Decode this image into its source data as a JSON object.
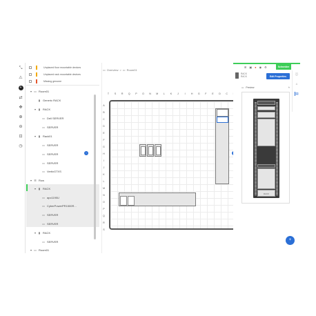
{
  "warnings": [
    {
      "label": "Unplaced floor mountable devices",
      "color": "#f2a900"
    },
    {
      "label": "Unplaced rack mountable devices",
      "color": "#f2a900"
    },
    {
      "label": "Missing genome",
      "color": "#e4572e"
    }
  ],
  "tree": [
    {
      "label": "Room01",
      "icon": "room-icon",
      "twisty": "▾"
    },
    {
      "label": "Generic RACK",
      "icon": "rack-icon"
    },
    {
      "label": "RACK",
      "icon": "rack-icon",
      "twisty": "▾"
    },
    {
      "label": "Dell SERVER",
      "icon": "server-icon"
    },
    {
      "label": "SERVER",
      "icon": "server-icon"
    },
    {
      "label": "Rack01",
      "icon": "rack-icon",
      "twisty": "▾"
    },
    {
      "label": "SERVER",
      "icon": "server-icon"
    },
    {
      "label": "SERVER",
      "icon": "server-icon"
    },
    {
      "label": "SERVER",
      "icon": "server-icon"
    },
    {
      "label": "VertivGTXS",
      "icon": "server-icon"
    },
    {
      "label": "Row",
      "icon": "row-icon",
      "twisty": "▾"
    },
    {
      "label": "RACK",
      "icon": "rack-icon",
      "twisty": "▾"
    },
    {
      "label": "apc1190U",
      "icon": "server-icon"
    },
    {
      "label": "CyberPowerPR1500R...",
      "icon": "server-icon"
    },
    {
      "label": "SERVER",
      "icon": "server-icon"
    },
    {
      "label": "SERVER",
      "icon": "server-icon"
    },
    {
      "label": "RACK",
      "icon": "rack-icon",
      "twisty": "▾"
    },
    {
      "label": "SERVER",
      "icon": "server-icon"
    },
    {
      "label": "Room01",
      "icon": "room-icon",
      "twisty": "▾"
    }
  ],
  "breadcrumb": {
    "root": "Overview",
    "sep": ">",
    "current": "Room01"
  },
  "ruler": {
    "top": [
      "T",
      "S",
      "R",
      "Q",
      "P",
      "O",
      "N",
      "M",
      "L",
      "K",
      "J",
      "I",
      "H",
      "G",
      "F",
      "E",
      "D",
      "C",
      "B",
      "A"
    ],
    "left": [
      "A",
      "B",
      "C",
      "D",
      "E",
      "F",
      "G",
      "H",
      "I",
      "J",
      "K",
      "L",
      "M",
      "N",
      "O",
      "P",
      "Q",
      "R",
      "S",
      "T",
      "U",
      "V",
      "W",
      "X",
      "Y",
      "Z"
    ],
    "right": [
      "1",
      "2",
      "3",
      "4",
      "5",
      "6",
      "7",
      "8",
      "9",
      "10",
      "11",
      "12",
      "13",
      "14",
      "15",
      "16",
      "17",
      "18",
      "19",
      "20"
    ]
  },
  "handles": {
    "left": "‹",
    "right": "›"
  },
  "header_icons": [
    "cart-icon",
    "box-icon",
    "bell-icon",
    "user-icon",
    "settings-icon"
  ],
  "brand": "Schneider",
  "panel": {
    "title_line1": "RACK",
    "title_line2": "RACK",
    "edit_label": "Edit Properties",
    "preview_label": "Preview",
    "preview_caption": "RACK"
  },
  "side_icons": [
    "info-icon",
    "home-icon",
    "layers-icon"
  ],
  "fab": "+",
  "colors": {
    "accent": "#3dcd58",
    "primary": "#2b6fd6"
  }
}
